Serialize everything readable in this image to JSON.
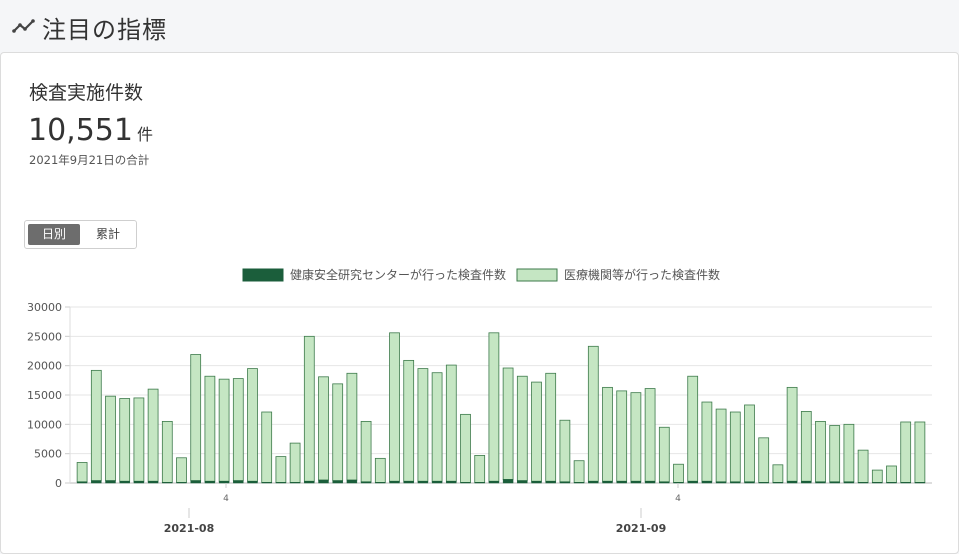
{
  "header": {
    "title": "注目の指標",
    "icon": "trend-line-icon"
  },
  "card": {
    "title": "検査実施件数",
    "total_value": "10,551",
    "total_unit": "件",
    "date_note": "2021年9月21日の合計"
  },
  "toggle": {
    "daily_label": "日別",
    "cumulative_label": "累計",
    "selected": "日別"
  },
  "colors": {
    "series_center": "#1b5e3b",
    "series_medical": "#c5e6c3",
    "bar_border": "#3d7a4b",
    "grid": "#e6e6e6"
  },
  "chart_data": {
    "type": "bar",
    "stacked": true,
    "legend_position": "top",
    "grid": true,
    "ylim": [
      0,
      30000
    ],
    "yticks": [
      "30000",
      "25000",
      "20000",
      "15000",
      "10000",
      "5000",
      "0"
    ],
    "x_minor_labels": [
      "4",
      "4"
    ],
    "x_major_labels": [
      "2021-08",
      "2021-09"
    ],
    "series": [
      {
        "name": "健康安全研究センターが行った検査件数",
        "values": [
          200,
          400,
          400,
          300,
          300,
          300,
          100,
          100,
          400,
          300,
          300,
          400,
          300,
          100,
          100,
          100,
          300,
          500,
          400,
          500,
          200,
          100,
          300,
          300,
          300,
          300,
          300,
          100,
          100,
          300,
          600,
          400,
          300,
          300,
          200,
          100,
          300,
          300,
          300,
          300,
          300,
          200,
          100,
          300,
          300,
          200,
          200,
          200,
          100,
          100,
          300,
          300,
          200,
          200,
          200,
          100,
          100,
          100,
          100,
          100
        ]
      },
      {
        "name": "医療機関等が行った検査件数",
        "values": [
          3300,
          18800,
          14400,
          14100,
          14200,
          15700,
          10400,
          4200,
          21500,
          17900,
          17400,
          17400,
          19200,
          12000,
          4400,
          6700,
          24700,
          17600,
          16500,
          18200,
          10300,
          4100,
          25300,
          20600,
          19200,
          18500,
          19800,
          11600,
          4600,
          25300,
          19000,
          17800,
          16900,
          18400,
          10500,
          3700,
          23000,
          16000,
          15400,
          15100,
          15800,
          9300,
          3100,
          17900,
          13500,
          12400,
          11900,
          13100,
          7600,
          3000,
          16000,
          11900,
          10300,
          9600,
          9800,
          5500,
          2100,
          2800,
          10300,
          10300
        ]
      }
    ]
  }
}
